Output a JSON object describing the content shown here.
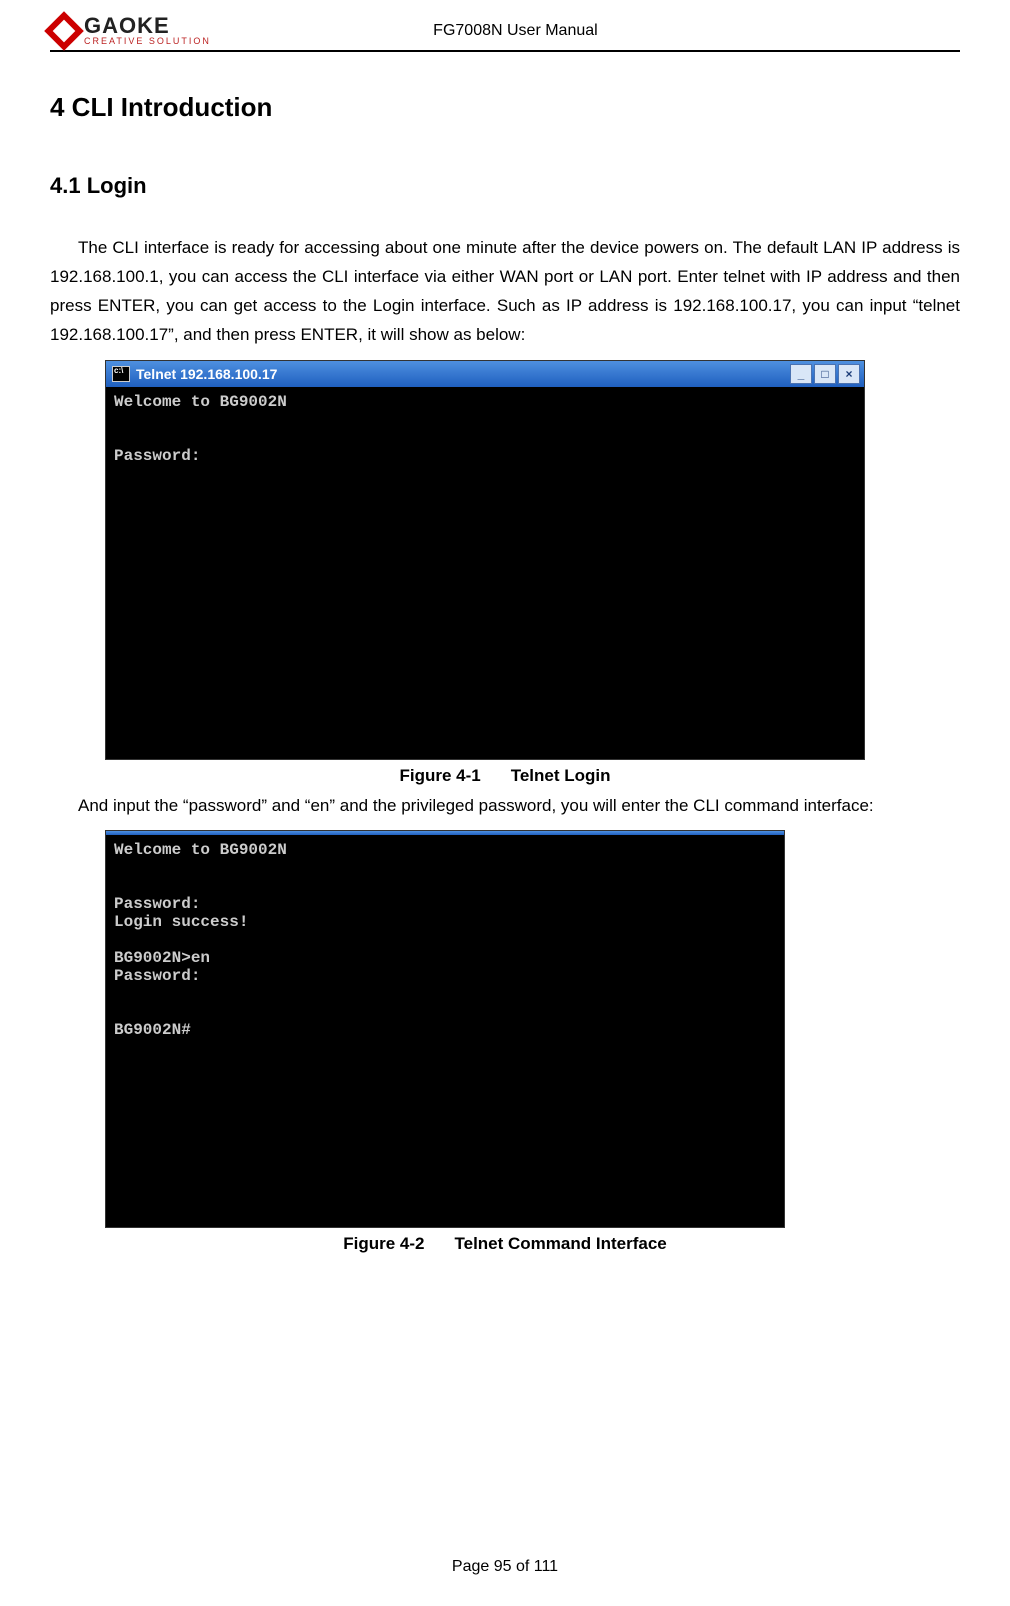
{
  "header": {
    "brand": "GAOKE",
    "tagline": "CREATIVE SOLUTION",
    "doc_title": "FG7008N User Manual"
  },
  "sections": {
    "h1": "4  CLI Introduction",
    "h2": "4.1 Login",
    "p1": "The CLI interface is ready for accessing about one minute after the device powers on. The default LAN IP address is 192.168.100.1, you can access the CLI interface via either WAN port or LAN port. Enter telnet with IP address and then press ENTER, you can get access to the Login interface. Such as IP address is 192.168.100.17, you can input “telnet 192.168.100.17”, and then press ENTER, it will show as below:",
    "p2": "And input the “password” and “en” and the privileged password, you will enter the CLI command interface:"
  },
  "figure1": {
    "title": "Telnet 192.168.100.17",
    "body": "Welcome to BG9002N\n\n\nPassword:",
    "caption_no": "Figure 4-1",
    "caption_text": "Telnet Login"
  },
  "figure2": {
    "body": "Welcome to BG9002N\n\n\nPassword:\nLogin success!\n\nBG9002N>en\nPassword:\n\n\nBG9002N#",
    "caption_no": "Figure 4-2",
    "caption_text": "Telnet Command Interface"
  },
  "footer": {
    "page_label": "Page 95 of 111"
  },
  "win_controls": {
    "min": "_",
    "max": "□",
    "close": "×"
  }
}
